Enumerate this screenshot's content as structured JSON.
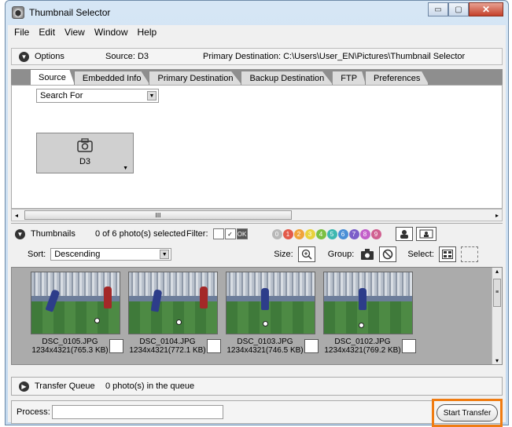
{
  "window": {
    "title": "Thumbnail Selector",
    "min_glyph": "▭",
    "max_glyph": "▢",
    "close_glyph": "✕"
  },
  "menu": [
    "File",
    "Edit",
    "View",
    "Window",
    "Help"
  ],
  "options": {
    "label": "Options",
    "source": "Source: D3",
    "destination": "Primary Destination:  C:\\Users\\User_EN\\Pictures\\Thumbnail Selector"
  },
  "tabs": [
    "Source",
    "Embedded Info",
    "Primary Destination",
    "Backup Destination",
    "FTP",
    "Preferences"
  ],
  "search": {
    "value": "Search For"
  },
  "device": {
    "name": "D3",
    "icon": "camera-icon"
  },
  "scroll_glyphs": {
    "left": "◂",
    "right": "▸",
    "grip": "III",
    "up": "▴",
    "down": "▾",
    "v_grip": "≡",
    "tri_down": "▼"
  },
  "thumbnails_bar": {
    "label": "Thumbnails",
    "selected": "0 of 6 photo(s) selected",
    "filter_label": "Filter:",
    "filter_icons": [
      "",
      "✓",
      "OK"
    ],
    "ratings": [
      "0",
      "1",
      "2",
      "3",
      "4",
      "5",
      "6",
      "7",
      "8",
      "9"
    ],
    "rating_colors": [
      "#b8b8b8",
      "#e35a4a",
      "#f0a33a",
      "#e9d23c",
      "#7bc043",
      "#3eb8b0",
      "#4a8fd6",
      "#7b5fc9",
      "#c25fc9",
      "#d06090"
    ]
  },
  "sort": {
    "label": "Sort:",
    "value": "Descending",
    "size_label": "Size:",
    "group_label": "Group:",
    "select_label": "Select:"
  },
  "photos": [
    {
      "name": "DSC_0105.JPG",
      "info": "1234x4321(765.3 KB)"
    },
    {
      "name": "DSC_0104.JPG",
      "info": "1234x4321(772.1 KB)"
    },
    {
      "name": "DSC_0103.JPG",
      "info": "1234x4321(746.5 KB)"
    },
    {
      "name": "DSC_0102.JPG",
      "info": "1234x4321(769.2 KB)"
    }
  ],
  "queue": {
    "label": "Transfer Queue",
    "count": "0 photo(s) in the queue"
  },
  "process": {
    "label": "Process:",
    "value": ""
  },
  "start_button": "Start Transfer",
  "colors": {
    "highlight": "#f07c12"
  }
}
